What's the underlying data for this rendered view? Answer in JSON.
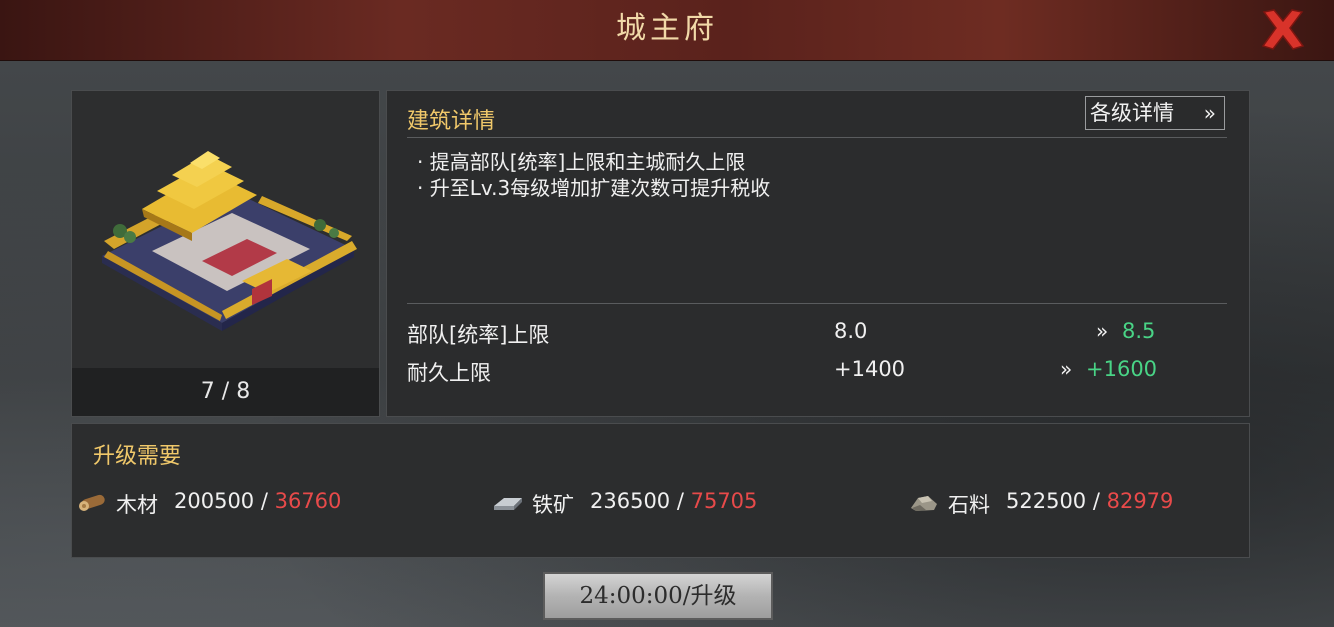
{
  "header": {
    "title": "城主府"
  },
  "building": {
    "level_progress": "7 / 8"
  },
  "details": {
    "title": "建筑详情",
    "levels_button": "各级详情",
    "descriptions": [
      "· 提高部队[统率]上限和主城耐久上限",
      "· 升至Lv.3每级增加扩建次数可提升税收"
    ],
    "stats": [
      {
        "label": "部队[统率]上限",
        "current": "8.0",
        "next": "8.5"
      },
      {
        "label": "耐久上限",
        "current": "+1400",
        "next": "+1600"
      }
    ]
  },
  "requirements": {
    "title": "升级需要",
    "resources": [
      {
        "icon": "wood-log-icon",
        "name": "木材",
        "required": "200500 / ",
        "owned": "36760"
      },
      {
        "icon": "iron-ingot-icon",
        "name": "铁矿",
        "required": "236500 / ",
        "owned": "75705"
      },
      {
        "icon": "stone-icon",
        "name": "石料",
        "required": "522500 / ",
        "owned": "82979"
      }
    ]
  },
  "upgrade_button": {
    "label": "24:00:00/升级"
  },
  "colors": {
    "accent_gold": "#f0c86a",
    "increase_green": "#49d486",
    "insufficient_red": "#e84a4a",
    "close_red": "#d8332a"
  }
}
